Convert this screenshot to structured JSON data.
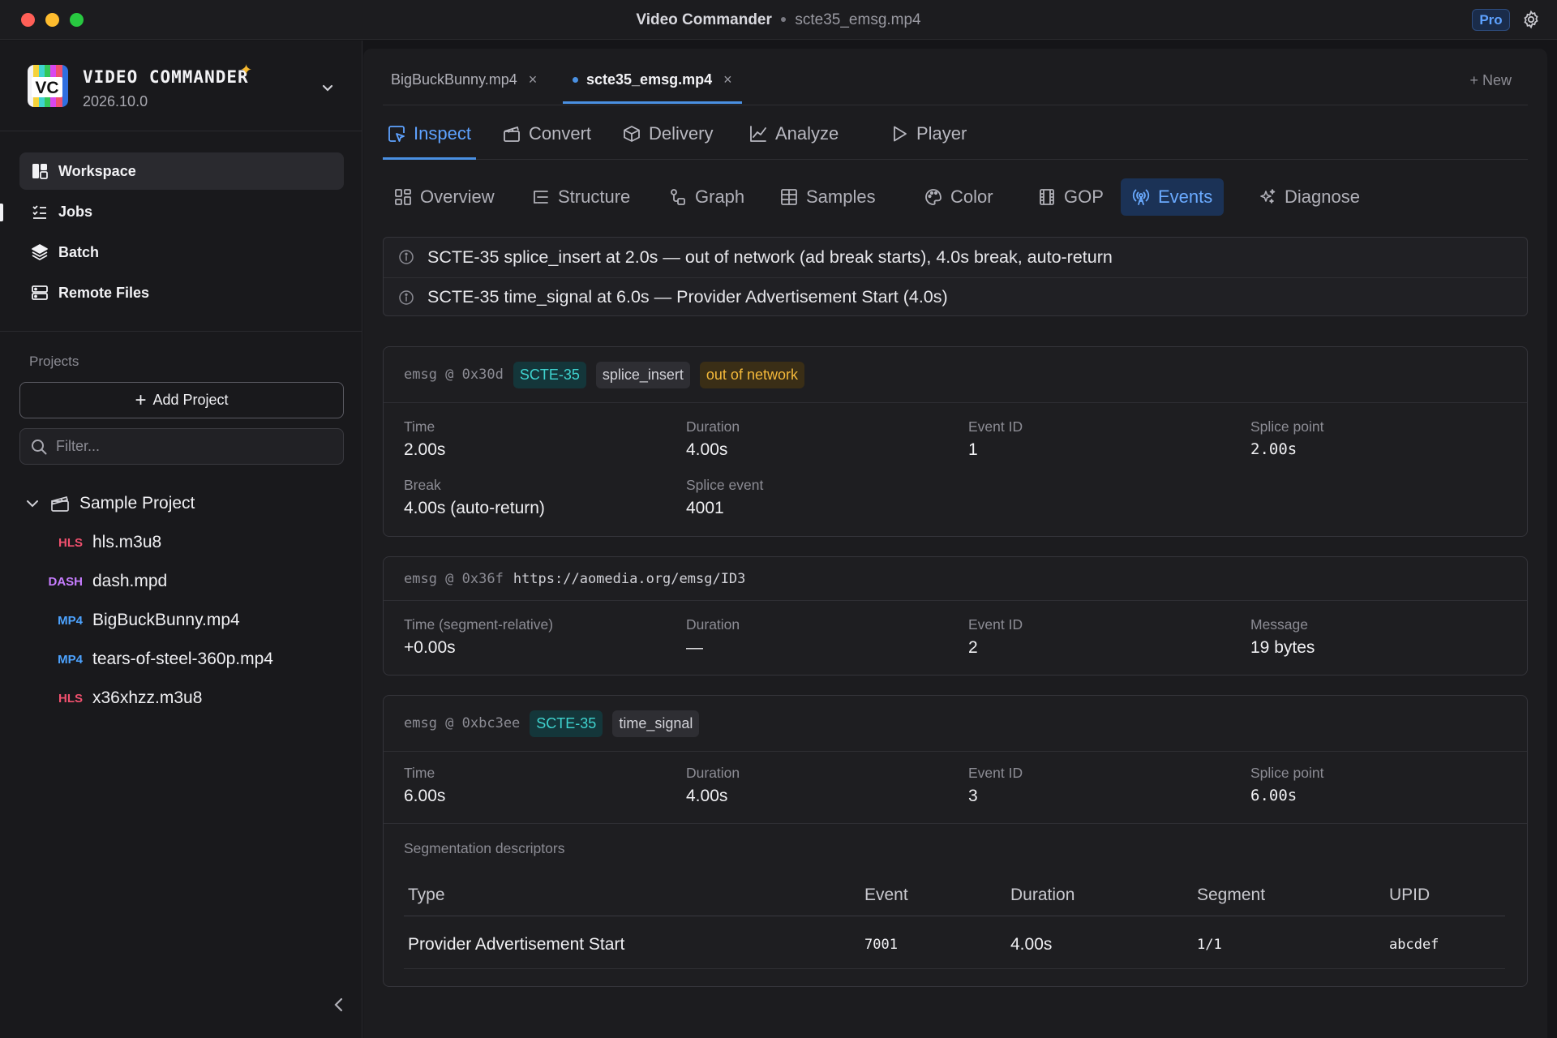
{
  "window": {
    "app_title": "Video Commander",
    "file_title": "scte35_emsg.mp4",
    "pro_badge": "Pro"
  },
  "sidebar": {
    "brand_name": "VIDEO COMMANDER",
    "brand_logo_text": "VC",
    "version": "2026.10.0",
    "nav": [
      {
        "label": "Workspace",
        "icon": "workspace-icon",
        "active": true
      },
      {
        "label": "Jobs",
        "icon": "jobs-icon"
      },
      {
        "label": "Batch",
        "icon": "layers-icon"
      },
      {
        "label": "Remote Files",
        "icon": "server-icon"
      }
    ],
    "projects_label": "Projects",
    "add_project_label": "Add Project",
    "filter_placeholder": "Filter...",
    "project_name": "Sample Project",
    "files": [
      {
        "tag": "HLS",
        "name": "hls.m3u8",
        "tag_color": "#f0506e"
      },
      {
        "tag": "DASH",
        "name": "dash.mpd",
        "tag_color": "#c77dff"
      },
      {
        "tag": "MP4",
        "name": "BigBuckBunny.mp4",
        "tag_color": "#4da3ff"
      },
      {
        "tag": "MP4",
        "name": "tears-of-steel-360p.mp4",
        "tag_color": "#4da3ff"
      },
      {
        "tag": "HLS",
        "name": "x36xhzz.m3u8",
        "tag_color": "#f0506e"
      }
    ]
  },
  "file_tabs": [
    {
      "label": "BigBuckBunny.mp4",
      "close": "×",
      "active": false
    },
    {
      "label": "scte35_emsg.mp4",
      "close": "×",
      "active": true
    }
  ],
  "new_tab_label": "+ New",
  "mode_tabs": [
    {
      "label": "Inspect",
      "icon": "inspect-icon",
      "active": true
    },
    {
      "label": "Convert",
      "icon": "convert-icon"
    },
    {
      "label": "Delivery",
      "icon": "package-icon"
    },
    {
      "label": "Analyze",
      "icon": "chart-line-icon"
    },
    {
      "label": "Player",
      "icon": "play-icon"
    }
  ],
  "sub_tabs": [
    {
      "label": "Overview",
      "icon": "overview-icon"
    },
    {
      "label": "Structure",
      "icon": "structure-icon"
    },
    {
      "label": "Graph",
      "icon": "graph-icon"
    },
    {
      "label": "Samples",
      "icon": "table-icon"
    },
    {
      "label": "Color",
      "icon": "palette-icon"
    },
    {
      "label": "GOP",
      "icon": "film-icon"
    },
    {
      "label": "Events",
      "icon": "broadcast-icon",
      "active": true
    },
    {
      "label": "Diagnose",
      "icon": "sparkle-icon"
    }
  ],
  "notices": [
    "SCTE-35 splice_insert at 2.0s — out of network (ad break starts), 4.0s break, auto-return",
    "SCTE-35 time_signal at 6.0s — Provider Advertisement Start (4.0s)"
  ],
  "events": [
    {
      "ref": "emsg @ 0x30d",
      "chips": [
        "SCTE-35",
        "splice_insert",
        "out of network"
      ],
      "fields": [
        {
          "k": "Time",
          "v": "2.00s"
        },
        {
          "k": "Duration",
          "v": "4.00s"
        },
        {
          "k": "Event ID",
          "v": "1"
        },
        {
          "k": "Splice point",
          "v": "2.00s"
        },
        {
          "k": "Break",
          "v": "4.00s (auto-return)"
        },
        {
          "k": "Splice event",
          "v": "4001"
        }
      ]
    },
    {
      "ref": "emsg @ 0x36f",
      "url": "https://aomedia.org/emsg/ID3",
      "fields": [
        {
          "k": "Time (segment-relative)",
          "v": "+0.00s"
        },
        {
          "k": "Duration",
          "v": "—"
        },
        {
          "k": "Event ID",
          "v": "2"
        },
        {
          "k": "Message",
          "v": "19 bytes"
        }
      ]
    },
    {
      "ref": "emsg @ 0xbc3ee",
      "chips": [
        "SCTE-35",
        "time_signal"
      ],
      "fields": [
        {
          "k": "Time",
          "v": "6.00s"
        },
        {
          "k": "Duration",
          "v": "4.00s"
        },
        {
          "k": "Event ID",
          "v": "3"
        },
        {
          "k": "Splice point",
          "v": "6.00s"
        }
      ],
      "segmentation": {
        "title": "Segmentation descriptors",
        "headers": [
          "Type",
          "Event",
          "Duration",
          "Segment",
          "UPID"
        ],
        "rows": [
          [
            "Provider Advertisement Start",
            "7001",
            "4.00s",
            "1/1",
            "abcdef"
          ]
        ]
      }
    }
  ]
}
